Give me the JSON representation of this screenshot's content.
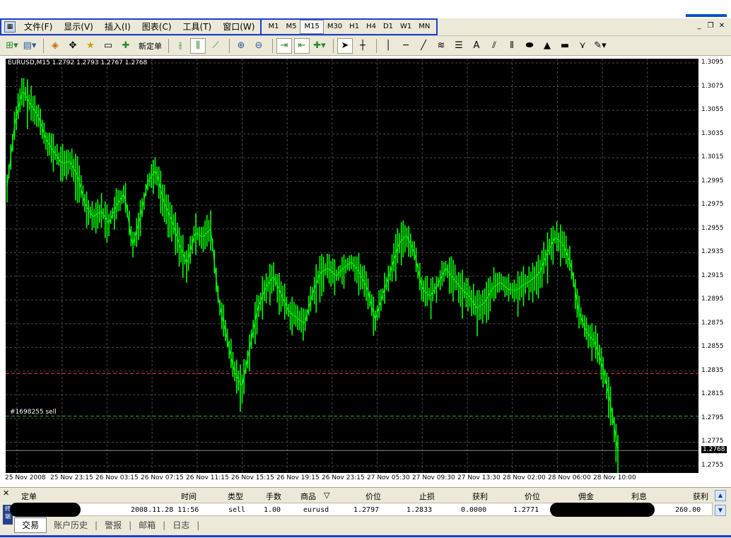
{
  "menu": {
    "items": [
      "文件(F)",
      "显示(V)",
      "插入(I)",
      "图表(C)",
      "工具(T)",
      "窗口(W)"
    ],
    "timeframes": [
      "M1",
      "M5",
      "M15",
      "M30",
      "H1",
      "H4",
      "D1",
      "W1",
      "MN"
    ],
    "active_timeframe": "M15"
  },
  "toolbar": {
    "new_order_label": "新定单"
  },
  "chart": {
    "header": "EURUSD,M15  1.2792 1.2793 1.2767 1.2768",
    "order_label": "#1698255 sell",
    "bg": "#000000",
    "candle_color": "#00ff00",
    "stop_line_color": "#ff3b3b",
    "entry_line_color": "#22b022"
  },
  "chart_data": {
    "type": "line",
    "symbol": "EURUSD",
    "timeframe": "M15",
    "ylim": [
      1.2755,
      1.3095
    ],
    "yticks": [
      "1.3095",
      "1.3075",
      "1.3055",
      "1.3035",
      "1.3015",
      "1.2995",
      "1.2975",
      "1.2955",
      "1.2935",
      "1.2915",
      "1.2895",
      "1.2875",
      "1.2855",
      "1.2835",
      "1.2815",
      "1.2795",
      "1.2775",
      "1.2755"
    ],
    "current_price": "1.2768",
    "xticks": [
      "25 Nov 2008",
      "25 Nov 23:15",
      "26 Nov 03:15",
      "26 Nov 07:15",
      "26 Nov 11:15",
      "26 Nov 15:15",
      "26 Nov 19:15",
      "26 Nov 23:15",
      "27 Nov 05:30",
      "27 Nov 09:30",
      "27 Nov 13:30",
      "28 Nov 02:00",
      "28 Nov 06:00",
      "28 Nov 10:00"
    ],
    "stop_loss_level": 1.2833,
    "entry_level": 1.2797,
    "series": [
      {
        "values": [
          1.299,
          1.3045,
          1.3072,
          1.306,
          1.305,
          1.303,
          1.302,
          1.301,
          1.3012,
          1.3,
          1.2975,
          1.2965,
          1.297,
          1.296,
          1.2975,
          1.2985,
          1.294,
          1.2965,
          1.2995,
          1.3005,
          1.2978,
          1.2963,
          1.2942,
          1.2925,
          1.2952,
          1.2948,
          1.2955,
          1.2895,
          1.2865,
          1.2835,
          1.2822,
          1.2855,
          1.2888,
          1.2905,
          1.2915,
          1.29,
          1.2885,
          1.288,
          1.2875,
          1.29,
          1.2918,
          1.2922,
          1.2915,
          1.2922,
          1.2927,
          1.2918,
          1.2905,
          1.2878,
          1.29,
          1.292,
          1.2942,
          1.295,
          1.2935,
          1.2905,
          1.2898,
          1.2908,
          1.2922,
          1.2913,
          1.2905,
          1.2898,
          1.2888,
          1.2893,
          1.2905,
          1.291,
          1.2904,
          1.2903,
          1.2908,
          1.2912,
          1.2918,
          1.2935,
          1.2948,
          1.2942,
          1.2925,
          1.2885,
          1.2868,
          1.286,
          1.284,
          1.281,
          1.2768
        ]
      }
    ]
  },
  "terminal": {
    "columns": [
      "定单",
      "时间",
      "类型",
      "手数",
      "商品",
      "价位",
      "止损",
      "获利",
      "价位",
      "佣金",
      "利息",
      "获利"
    ],
    "sort_marker": "▽",
    "row": {
      "time": "2008.11.28 11:56",
      "type": "sell",
      "lots": "1.00",
      "symbol": "eurusd",
      "open_price": "1.2797",
      "stop_loss": "1.2833",
      "take_profit": "0.0000",
      "price": "1.2771",
      "profit": "260.00"
    },
    "tabs": [
      "交易",
      "账户历史",
      "警报",
      "邮箱",
      "日志"
    ],
    "side_label": "终端"
  }
}
